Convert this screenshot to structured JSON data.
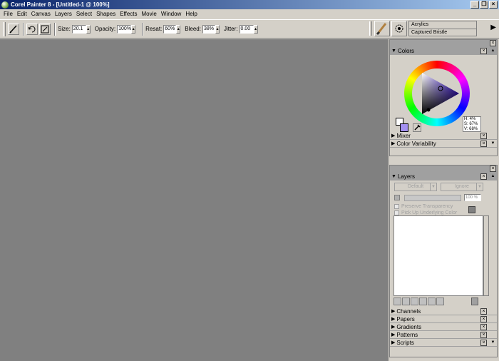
{
  "window": {
    "title": "Corel Painter 8 - [Untitled-1 @ 100%]",
    "minimize": "_",
    "restore": "❐",
    "close": "×"
  },
  "menu": [
    "File",
    "Edit",
    "Canvas",
    "Layers",
    "Select",
    "Shapes",
    "Effects",
    "Movie",
    "Window",
    "Help"
  ],
  "propbar": {
    "size_label": "Size:",
    "size_value": "20.1",
    "opacity_label": "Opacity:",
    "opacity_value": "100%",
    "resat_label": "Resat:",
    "resat_value": "60%",
    "bleed_label": "Bleed:",
    "bleed_value": "38%",
    "jitter_label": "Jitter:",
    "jitter_value": "0.00",
    "brush_category": "Acrylics",
    "brush_variant": "Captured Bristle"
  },
  "colors_palette": {
    "title": "Colors",
    "h": "H: 4%",
    "s": "S: 67%",
    "v": "V: 68%",
    "main_color": "#a390f0"
  },
  "collapsed_top": [
    "Mixer",
    "Color Variability"
  ],
  "layers_palette": {
    "title": "Layers",
    "composite_method": "Default",
    "ignore": "Ignore",
    "opacity": "100 %",
    "preserve_transparency": "Preserve Transparency",
    "pick_up_color": "Pick Up Underlying Color"
  },
  "collapsed_bottom": [
    "Channels",
    "Papers",
    "Gradients",
    "Patterns",
    "Scripts"
  ]
}
